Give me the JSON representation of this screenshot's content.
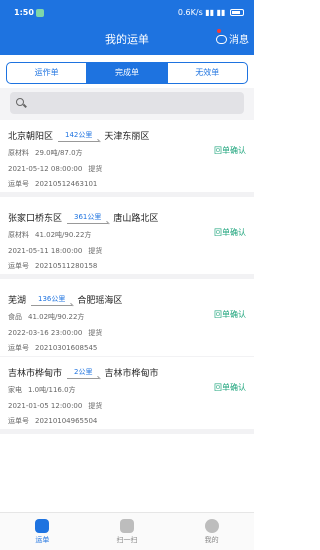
{
  "status_bar": {
    "time": "1:50",
    "net_speed": "0.6K/s",
    "battery": "56"
  },
  "header": {
    "title": "我的运单",
    "message_label": "消息"
  },
  "tabs": [
    {
      "label": "运作单"
    },
    {
      "label": "完成单"
    },
    {
      "label": "无效单"
    }
  ],
  "search": {
    "placeholder": ""
  },
  "orders": [
    {
      "from": "北京朝阳区",
      "distance": "142公里",
      "to": "天津东丽区",
      "cargo": "原材料",
      "weight": "29.0吨/87.0方",
      "datetime": "2021-05-12 08:00:00",
      "action": "提货",
      "waybill_label": "运单号",
      "waybill": "20210512463101",
      "status": "回单确认"
    },
    {
      "from": "张家口桥东区",
      "distance": "361公里",
      "to": "唐山路北区",
      "cargo": "原材料",
      "weight": "41.02吨/90.22方",
      "datetime": "2021-05-11 18:00:00",
      "action": "提货",
      "waybill_label": "运单号",
      "waybill": "20210511280158",
      "status": "回单确认"
    },
    {
      "from": "芜湖",
      "distance": "136公里",
      "to": "合肥瑶海区",
      "cargo": "食品",
      "weight": "41.02吨/90.22方",
      "datetime": "2022-03-16 23:00:00",
      "action": "提货",
      "waybill_label": "运单号",
      "waybill": "20210301608545",
      "status": "回单确认"
    },
    {
      "from": "吉林市桦甸市",
      "distance": "2公里",
      "to": "吉林市桦甸市",
      "cargo": "家电",
      "weight": "1.0吨/116.0方",
      "datetime": "2021-01-05 12:00:00",
      "action": "提货",
      "waybill_label": "运单号",
      "waybill": "20210104965504",
      "status": "回单确认"
    }
  ],
  "bottom_nav": [
    {
      "label": "运单",
      "icon": "waybill-icon"
    },
    {
      "label": "扫一扫",
      "icon": "scan-icon"
    },
    {
      "label": "我的",
      "icon": "profile-icon"
    }
  ],
  "colors": {
    "primary": "#1e73e0",
    "confirm": "#1aa37a"
  }
}
